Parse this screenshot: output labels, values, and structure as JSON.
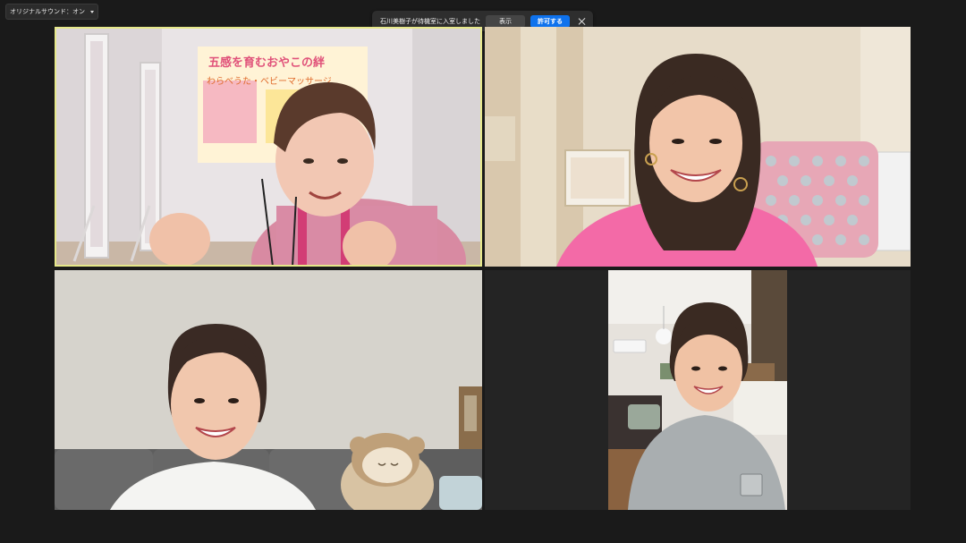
{
  "toolbar": {
    "original_sound_label": "オリジナルサウンド：オン"
  },
  "notification": {
    "message": "石川美樹子が待機室に入室しました",
    "view_label": "表示",
    "admit_label": "許可する"
  },
  "poster": {
    "title": "五感を育むおやこの絆",
    "subtitle": "わらべうた・ベビーマッサージ"
  },
  "colors": {
    "admit_button": "#0e72ed",
    "active_speaker_border": "#e6e88a",
    "background": "#1a1a1a"
  }
}
